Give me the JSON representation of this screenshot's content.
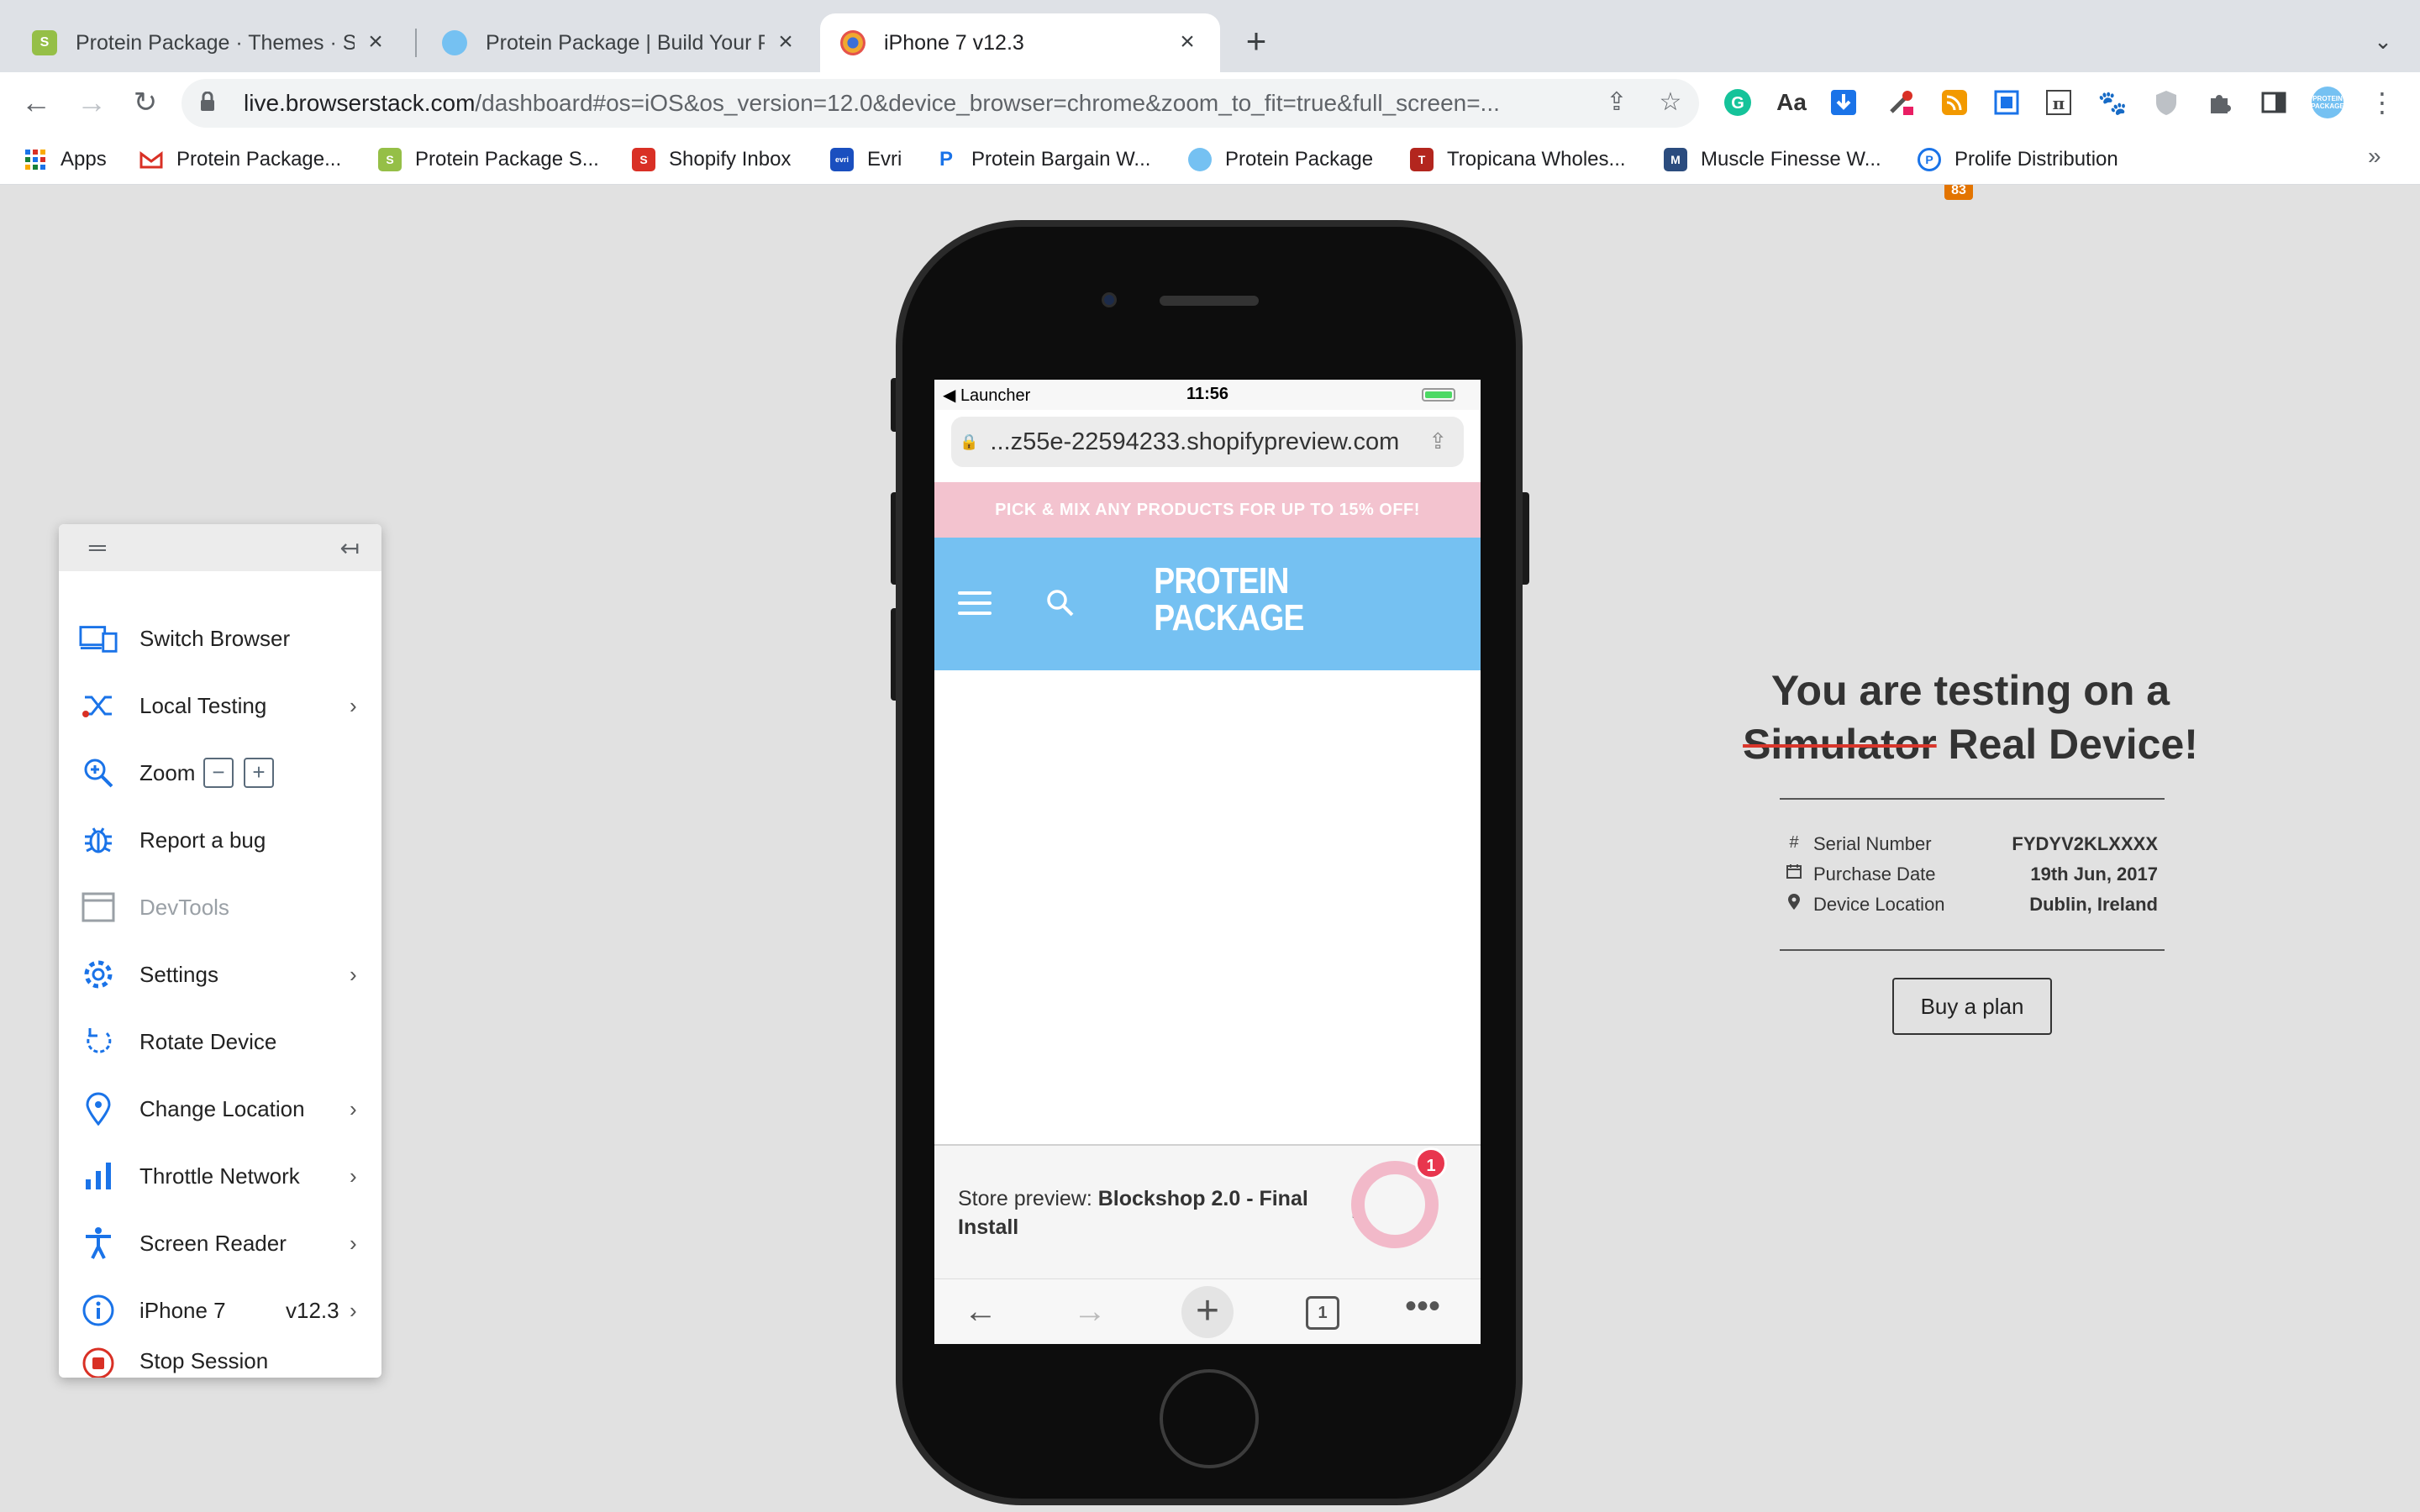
{
  "browser": {
    "tabs": [
      {
        "title": "Protein Package · Themes · Sh",
        "favicon_color": "#95bf47"
      },
      {
        "title": "Protein Package | Build Your Pr",
        "favicon_color": "#75c1f2"
      },
      {
        "title": "iPhone 7 v12.3",
        "favicon_color": "#f0a830"
      }
    ],
    "url_host": "live.browserstack.com",
    "url_path": "/dashboard#os=iOS&os_version=12.0&device_browser=chrome&zoom_to_fit=true&full_screen=...",
    "extension_badge": "83",
    "bookmarks": [
      {
        "label": "Apps",
        "icon": "apps-grid-icon"
      },
      {
        "label": "Protein Package...",
        "icon": "gmail-icon"
      },
      {
        "label": "Protein Package S...",
        "icon": "shopify-icon"
      },
      {
        "label": "Shopify Inbox",
        "icon": "shopify-inbox-icon"
      },
      {
        "label": "Evri",
        "icon": "evri-icon"
      },
      {
        "label": "Protein Bargain W...",
        "icon": "pb-icon"
      },
      {
        "label": "Protein Package",
        "icon": "pp-icon"
      },
      {
        "label": "Tropicana Wholes...",
        "icon": "tropicana-icon"
      },
      {
        "label": "Muscle Finesse W...",
        "icon": "muscle-finesse-icon"
      },
      {
        "label": "Prolife Distribution",
        "icon": "prolife-icon"
      }
    ]
  },
  "sidebar": {
    "items": [
      {
        "label": "Switch Browser",
        "icon": "switch-browser-icon"
      },
      {
        "label": "Local Testing",
        "icon": "local-testing-icon"
      },
      {
        "label": "Zoom",
        "icon": "zoom-icon"
      },
      {
        "label": "Report a bug",
        "icon": "bug-icon"
      },
      {
        "label": "DevTools",
        "icon": "devtools-icon"
      },
      {
        "label": "Settings",
        "icon": "gear-icon"
      },
      {
        "label": "Rotate Device",
        "icon": "rotate-icon"
      },
      {
        "label": "Change Location",
        "icon": "location-pin-icon"
      },
      {
        "label": "Throttle Network",
        "icon": "signal-bars-icon"
      },
      {
        "label": "Screen Reader",
        "icon": "accessibility-icon"
      },
      {
        "label": "iPhone 7",
        "icon": "info-icon",
        "value": "v12.3"
      },
      {
        "label": "Stop Session",
        "icon": "stop-icon"
      }
    ],
    "zoom_minus": "−",
    "zoom_plus": "+"
  },
  "device": {
    "status_launcher": "Launcher",
    "status_time": "11:56",
    "url": "...z55e-22594233.shopifypreview.com",
    "promo": "PICK & MIX ANY PRODUCTS FOR UP TO 15% OFF!",
    "logo_line1": "PROTEIN",
    "logo_line2": "PACKAGE",
    "preview_prefix": "Store preview: ",
    "preview_theme": "Blockshop 2.0 - Final Install",
    "chat_badge": "1",
    "tab_count": "1"
  },
  "info": {
    "title_line1": "You are testing on a",
    "title_struck": "Simulator",
    "title_rest": " Real Device!",
    "rows": [
      {
        "icon": "hash-icon",
        "label": "Serial Number",
        "value": "FYDYV2KLXXXX"
      },
      {
        "icon": "calendar-icon",
        "label": "Purchase Date",
        "value": "19th Jun, 2017"
      },
      {
        "icon": "location-pin-icon",
        "label": "Device Location",
        "value": "Dublin, Ireland"
      }
    ],
    "button": "Buy a plan"
  },
  "colors": {
    "accent_blue": "#1a73e8",
    "site_header": "#75c1f2",
    "promo_bg": "#f3c3cf",
    "stop_red": "#d93025"
  }
}
